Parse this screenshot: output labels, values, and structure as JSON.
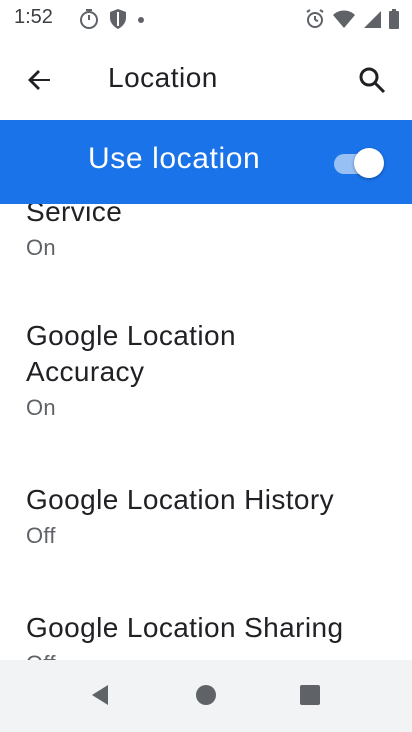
{
  "status_bar": {
    "time": "1:52",
    "icons": [
      "timer-icon",
      "shield-icon",
      "dot-icon",
      "alarm-icon",
      "wifi-icon",
      "cell-signal-icon",
      "battery-icon"
    ]
  },
  "app_bar": {
    "title": "Location",
    "back_icon": "back-arrow-icon",
    "search_icon": "search-icon"
  },
  "use_location": {
    "label": "Use location",
    "enabled": true,
    "accent": "#1a73e8"
  },
  "items": [
    {
      "title": "Service",
      "subtitle": "On"
    },
    {
      "title_line1": "Google Location",
      "title_line2": "Accuracy",
      "subtitle": "On"
    },
    {
      "title": "Google Location History",
      "subtitle": "Off"
    },
    {
      "title": "Google Location Sharing",
      "subtitle": "Off"
    }
  ],
  "nav_bar": {
    "icons": [
      "nav-back-icon",
      "nav-home-icon",
      "nav-recents-icon"
    ]
  }
}
